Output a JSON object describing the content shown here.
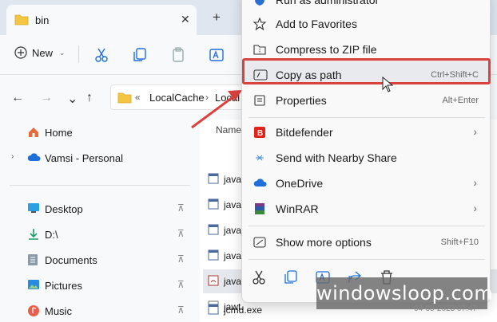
{
  "window": {
    "tab_title": "bin",
    "close_glyph": "✕",
    "new_tab_glyph": "+"
  },
  "toolbar": {
    "new_label": "New",
    "new_chevron": "⌄"
  },
  "address": {
    "overflow": "«",
    "segment1": "LocalCache",
    "separator": "›",
    "segment2": "Local"
  },
  "nav_pane": {
    "items": [
      {
        "label": "Home",
        "icon": "home-icon"
      },
      {
        "label": "Vamsi - Personal",
        "icon": "onedrive-cloud-icon"
      },
      {
        "label": "Desktop",
        "icon": "desktop-icon"
      },
      {
        "label": "D:\\",
        "icon": "download-arrow-icon"
      },
      {
        "label": "Documents",
        "icon": "documents-icon"
      },
      {
        "label": "Pictures",
        "icon": "pictures-icon"
      },
      {
        "label": "Music",
        "icon": "music-icon"
      }
    ],
    "pin_glyph": "📌",
    "expand_glyph": "›"
  },
  "file_pane": {
    "column_name": "Name",
    "files": [
      "javac",
      "javac",
      "javaj",
      "javap",
      "javav",
      "jawt.",
      "jcmd.exe"
    ],
    "date_fragment": "04-05-2023 07:47"
  },
  "context_menu": {
    "items": [
      {
        "label": "Run as administrator",
        "icon": "shield-icon"
      },
      {
        "label": "Add to Favorites",
        "icon": "star-icon"
      },
      {
        "label": "Compress to ZIP file",
        "icon": "zip-icon"
      },
      {
        "label": "Copy as path",
        "icon": "copy-path-icon",
        "shortcut": "Ctrl+Shift+C"
      },
      {
        "label": "Properties",
        "icon": "properties-icon",
        "shortcut": "Alt+Enter"
      },
      {
        "label": "Bitdefender",
        "icon": "bitdefender-icon",
        "submenu": true
      },
      {
        "label": "Send with Nearby Share",
        "icon": "nearby-share-icon"
      },
      {
        "label": "OneDrive",
        "icon": "onedrive-icon",
        "submenu": true
      },
      {
        "label": "WinRAR",
        "icon": "winrar-icon",
        "submenu": true
      },
      {
        "label": "Show more options",
        "icon": "more-options-icon",
        "shortcut": "Shift+F10"
      }
    ],
    "submenu_glyph": "›",
    "bottom_actions": [
      "cut-icon",
      "copy-icon",
      "rename-icon",
      "share-icon",
      "delete-icon"
    ]
  },
  "watermark": "windowsloop.com",
  "colors": {
    "highlight_border": "#d9423d",
    "folder_yellow": "#f4c542",
    "accent_blue": "#1e6fd9"
  }
}
